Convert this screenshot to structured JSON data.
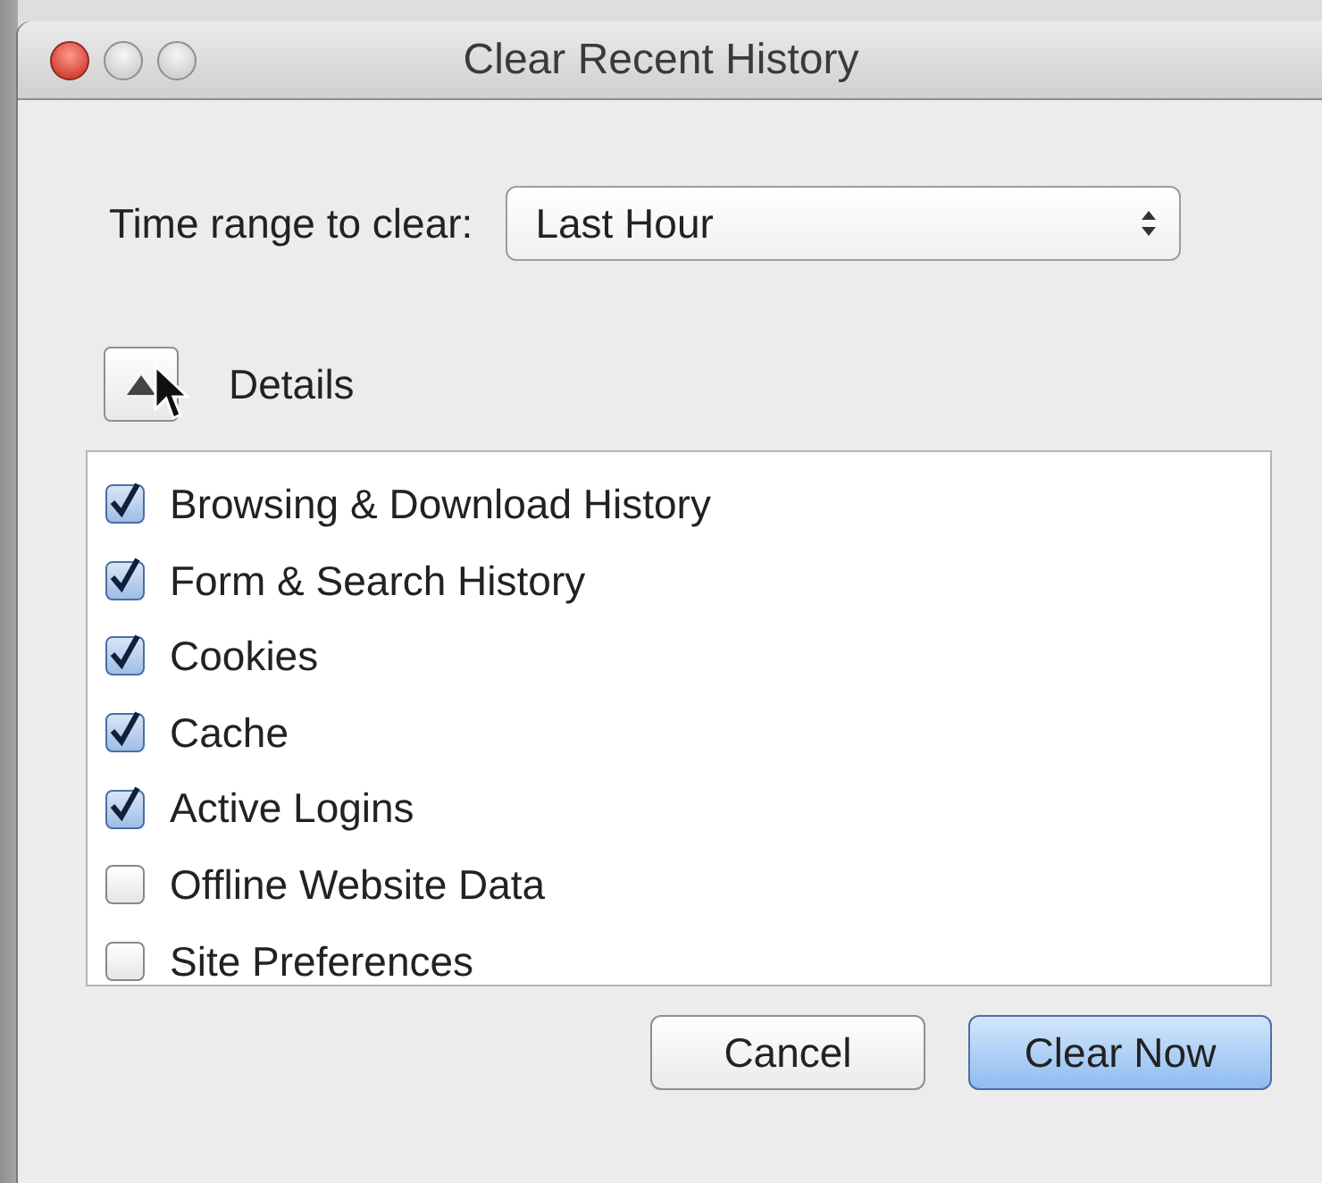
{
  "window": {
    "title": "Clear Recent History"
  },
  "time_range": {
    "label": "Time range to clear:",
    "value": "Last Hour"
  },
  "details": {
    "label": "Details",
    "expanded": true
  },
  "items": [
    {
      "label": "Browsing & Download History",
      "checked": true
    },
    {
      "label": "Form & Search History",
      "checked": true
    },
    {
      "label": "Cookies",
      "checked": true
    },
    {
      "label": "Cache",
      "checked": true
    },
    {
      "label": "Active Logins",
      "checked": true
    },
    {
      "label": "Offline Website Data",
      "checked": false
    },
    {
      "label": "Site Preferences",
      "checked": false
    }
  ],
  "buttons": [
    {
      "label": "Cancel",
      "kind": "normal"
    },
    {
      "label": "Clear Now",
      "kind": "default"
    }
  ]
}
